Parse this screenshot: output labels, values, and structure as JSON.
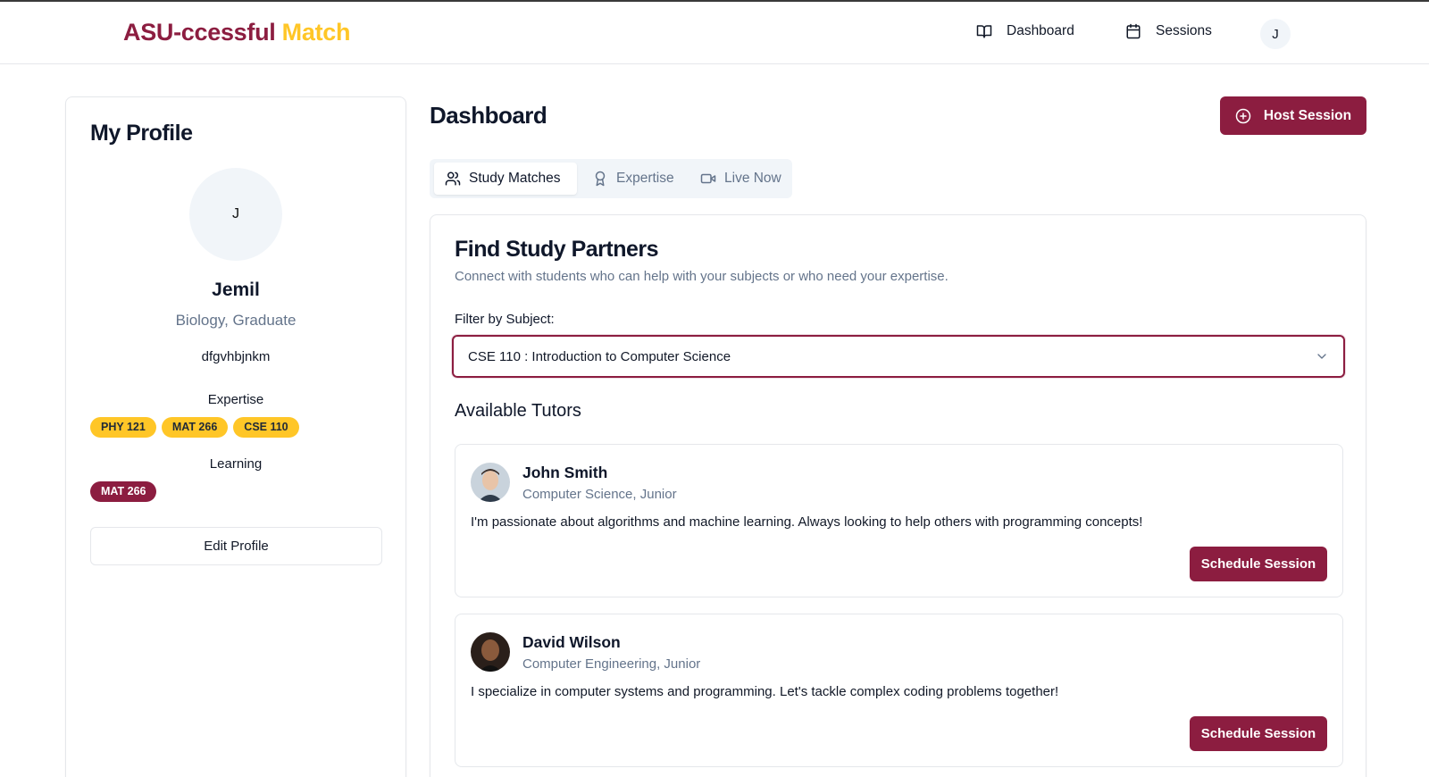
{
  "brand": {
    "part1": "ASU-ccessful",
    "part2": "Match",
    "color_maroon": "#8c1d40",
    "color_gold": "#ffc627"
  },
  "nav": {
    "dashboard": {
      "label": "Dashboard",
      "icon": "book-open-icon"
    },
    "sessions": {
      "label": "Sessions",
      "icon": "calendar-icon"
    },
    "avatar_initial": "J"
  },
  "profile": {
    "title": "My Profile",
    "avatar_initial": "J",
    "name": "Jemil",
    "major": "Biology, Graduate",
    "bio": "dfgvhbjnkm",
    "expertise_label": "Expertise",
    "expertise": [
      "PHY 121",
      "MAT 266",
      "CSE 110"
    ],
    "learning_label": "Learning",
    "learning": [
      "MAT 266"
    ],
    "edit_label": "Edit Profile"
  },
  "dashboard": {
    "title": "Dashboard",
    "host_label": "Host Session",
    "tabs": [
      {
        "label": "Study Matches",
        "icon": "users-icon",
        "active": true
      },
      {
        "label": "Expertise",
        "icon": "award-icon",
        "active": false
      },
      {
        "label": "Live Now",
        "icon": "video-icon",
        "active": false
      }
    ]
  },
  "find": {
    "title": "Find Study Partners",
    "subtitle": "Connect with students who can help with your subjects or who need your expertise.",
    "filter_label": "Filter by Subject:",
    "selected_subject": "CSE 110 : Introduction to Computer Science",
    "tutors_title": "Available Tutors",
    "tutors": [
      {
        "name": "John Smith",
        "major": "Computer Science, Junior",
        "bio": "I'm passionate about algorithms and machine learning. Always looking to help others with programming concepts!",
        "button": "Schedule Session"
      },
      {
        "name": "David Wilson",
        "major": "Computer Engineering, Junior",
        "bio": "I specialize in computer systems and programming. Let's tackle complex coding problems together!",
        "button": "Schedule Session"
      }
    ]
  }
}
